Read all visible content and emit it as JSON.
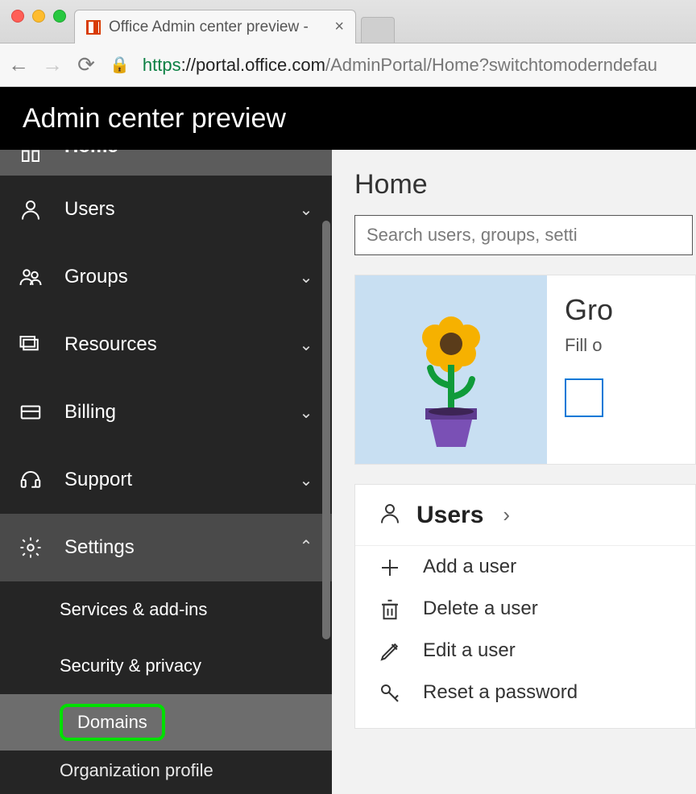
{
  "browser": {
    "tab_title": "Office Admin center preview -",
    "url_scheme": "https",
    "url_host": "://portal.office.com",
    "url_path": "/AdminPortal/Home?switchtomoderndefau"
  },
  "header": {
    "title": "Admin center preview"
  },
  "sidebar": {
    "home": "Home",
    "items": [
      {
        "label": "Users"
      },
      {
        "label": "Groups"
      },
      {
        "label": "Resources"
      },
      {
        "label": "Billing"
      },
      {
        "label": "Support"
      },
      {
        "label": "Settings"
      }
    ],
    "settings_children": [
      {
        "label": "Services & add-ins"
      },
      {
        "label": "Security & privacy"
      },
      {
        "label": "Domains"
      },
      {
        "label": "Organization profile"
      }
    ]
  },
  "main": {
    "title": "Home",
    "search_placeholder": "Search users, groups, setti",
    "promo_heading": "Gro",
    "promo_sub": "Fill o",
    "users_card": {
      "title": "Users",
      "rows": [
        {
          "label": "Add a user"
        },
        {
          "label": "Delete a user"
        },
        {
          "label": "Edit a user"
        },
        {
          "label": "Reset a password"
        }
      ]
    }
  }
}
